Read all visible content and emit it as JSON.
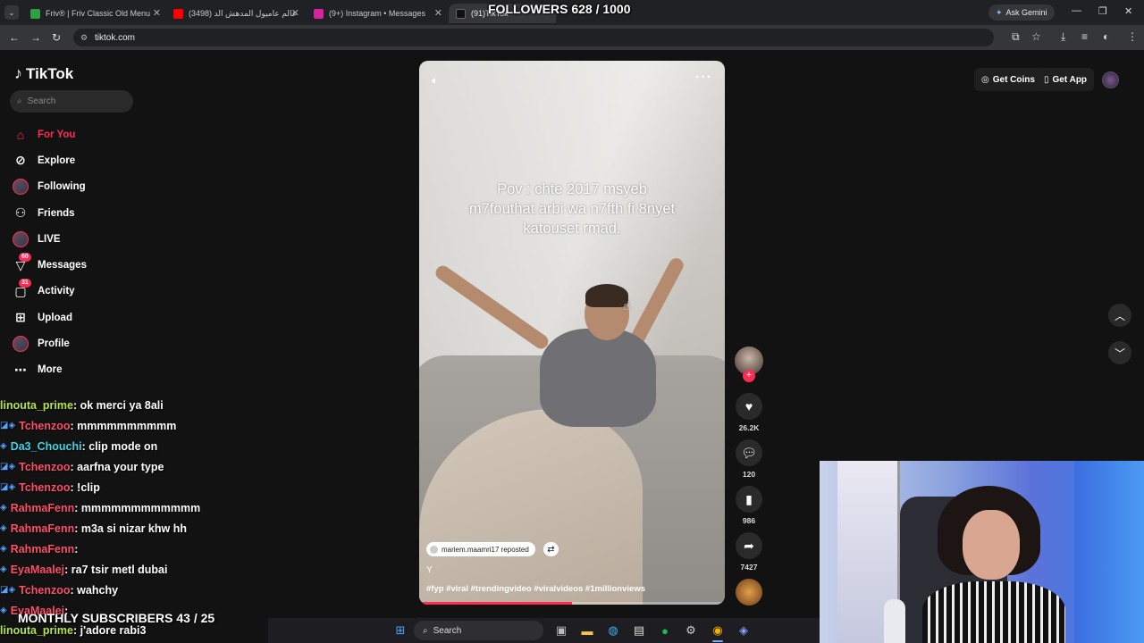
{
  "browser": {
    "tabs": [
      {
        "title": "Friv® | Friv Classic Old Menu",
        "color": "#2ea043"
      },
      {
        "title": "(3498) عالم عاميول المدهش الد",
        "color": "#ff0000"
      },
      {
        "title": "(9+) Instagram • Messages",
        "color": "#d6249f"
      },
      {
        "title": "(91)TikTok",
        "color": "#000000"
      }
    ],
    "ask_gemini": "Ask Gemini",
    "url": "tiktok.com"
  },
  "sidebar": {
    "logo": "TikTok",
    "search_placeholder": "Search",
    "items": [
      {
        "label": "For You",
        "icon": "home-icon",
        "active": true
      },
      {
        "label": "Explore",
        "icon": "compass-icon"
      },
      {
        "label": "Following",
        "icon": "following-avatar-icon"
      },
      {
        "label": "Friends",
        "icon": "friends-icon"
      },
      {
        "label": "LIVE",
        "icon": "live-avatar-icon"
      },
      {
        "label": "Messages",
        "icon": "messages-icon",
        "badge": "60"
      },
      {
        "label": "Activity",
        "icon": "activity-icon",
        "badge": "31"
      },
      {
        "label": "Upload",
        "icon": "upload-icon"
      },
      {
        "label": "Profile",
        "icon": "profile-avatar-icon"
      },
      {
        "label": "More",
        "icon": "more-icon"
      }
    ]
  },
  "header": {
    "get_coins": "Get Coins",
    "get_app": "Get App"
  },
  "video": {
    "caption": "Pov : chte 2017 msyeb m7fouthat arbi wa n7fth fi 8nyet katouset rmad.",
    "repost": "mariem.maamri17 reposted",
    "title": "Y",
    "tags": "#fyp #viral #trendingvideo #viralvideos #1millionviews",
    "progress": 0.5
  },
  "actions": {
    "likes": "26.2K",
    "comments": "120",
    "saves": "986",
    "shares": "7427"
  },
  "overlay": {
    "followers": "FOLLOWERS 628 / 1000",
    "monthly": "MONTHLY SUBSCRIBERS 43 / 25",
    "chat": [
      {
        "user": "linouta_prime",
        "msg": " : ok merci ya 8ali",
        "color": "#b7e34a",
        "badges": ""
      },
      {
        "user": "Tchenzoo",
        "msg": " : mmmmmmmmmm",
        "color": "#ff4f6a",
        "badges": "◪◈"
      },
      {
        "user": "Da3_Chouchi",
        "msg": " : clip mode on",
        "color": "#3fd6e8",
        "badges": "◈"
      },
      {
        "user": "Tchenzoo",
        "msg": " : aarfna your type",
        "color": "#ff4f6a",
        "badges": "◪◈"
      },
      {
        "user": "Tchenzoo",
        "msg": " : !clip",
        "color": "#ff4f6a",
        "badges": "◪◈"
      },
      {
        "user": "RahmaFenn",
        "msg": " : mmmmmmmmmmmm",
        "color": "#ff4f6a",
        "badges": "◈"
      },
      {
        "user": "RahmaFenn",
        "msg": " : m3a si nizar khw hh",
        "color": "#ff4f6a",
        "badges": "◈"
      },
      {
        "user": "RahmaFenn",
        "msg": " : ",
        "color": "#ff4f6a",
        "badges": "◈"
      },
      {
        "user": "EyaMaalej",
        "msg": " : ra7 tsir metl dubai",
        "color": "#ff4f6a",
        "badges": "◈"
      },
      {
        "user": "Tchenzoo",
        "msg": " : wahchy",
        "color": "#ff4f6a",
        "badges": "◪◈"
      },
      {
        "user": "EyaMaalej",
        "msg": " : ",
        "color": "#ff4f6a",
        "badges": "◈"
      },
      {
        "user": "linouta_prime",
        "msg": " : j'adore rabi3",
        "color": "#b7e34a",
        "badges": ""
      }
    ]
  },
  "taskbar": {
    "search": "Search"
  }
}
